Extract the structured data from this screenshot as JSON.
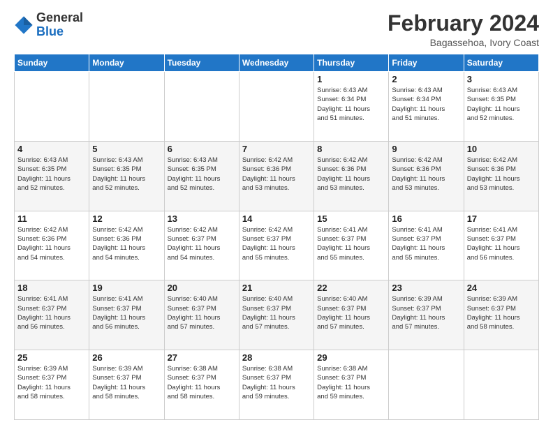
{
  "logo": {
    "general": "General",
    "blue": "Blue"
  },
  "title": "February 2024",
  "location": "Bagassehoa, Ivory Coast",
  "weekdays": [
    "Sunday",
    "Monday",
    "Tuesday",
    "Wednesday",
    "Thursday",
    "Friday",
    "Saturday"
  ],
  "weeks": [
    [
      {
        "day": "",
        "info": ""
      },
      {
        "day": "",
        "info": ""
      },
      {
        "day": "",
        "info": ""
      },
      {
        "day": "",
        "info": ""
      },
      {
        "day": "1",
        "info": "Sunrise: 6:43 AM\nSunset: 6:34 PM\nDaylight: 11 hours\nand 51 minutes."
      },
      {
        "day": "2",
        "info": "Sunrise: 6:43 AM\nSunset: 6:34 PM\nDaylight: 11 hours\nand 51 minutes."
      },
      {
        "day": "3",
        "info": "Sunrise: 6:43 AM\nSunset: 6:35 PM\nDaylight: 11 hours\nand 52 minutes."
      }
    ],
    [
      {
        "day": "4",
        "info": "Sunrise: 6:43 AM\nSunset: 6:35 PM\nDaylight: 11 hours\nand 52 minutes."
      },
      {
        "day": "5",
        "info": "Sunrise: 6:43 AM\nSunset: 6:35 PM\nDaylight: 11 hours\nand 52 minutes."
      },
      {
        "day": "6",
        "info": "Sunrise: 6:43 AM\nSunset: 6:35 PM\nDaylight: 11 hours\nand 52 minutes."
      },
      {
        "day": "7",
        "info": "Sunrise: 6:42 AM\nSunset: 6:36 PM\nDaylight: 11 hours\nand 53 minutes."
      },
      {
        "day": "8",
        "info": "Sunrise: 6:42 AM\nSunset: 6:36 PM\nDaylight: 11 hours\nand 53 minutes."
      },
      {
        "day": "9",
        "info": "Sunrise: 6:42 AM\nSunset: 6:36 PM\nDaylight: 11 hours\nand 53 minutes."
      },
      {
        "day": "10",
        "info": "Sunrise: 6:42 AM\nSunset: 6:36 PM\nDaylight: 11 hours\nand 53 minutes."
      }
    ],
    [
      {
        "day": "11",
        "info": "Sunrise: 6:42 AM\nSunset: 6:36 PM\nDaylight: 11 hours\nand 54 minutes."
      },
      {
        "day": "12",
        "info": "Sunrise: 6:42 AM\nSunset: 6:36 PM\nDaylight: 11 hours\nand 54 minutes."
      },
      {
        "day": "13",
        "info": "Sunrise: 6:42 AM\nSunset: 6:37 PM\nDaylight: 11 hours\nand 54 minutes."
      },
      {
        "day": "14",
        "info": "Sunrise: 6:42 AM\nSunset: 6:37 PM\nDaylight: 11 hours\nand 55 minutes."
      },
      {
        "day": "15",
        "info": "Sunrise: 6:41 AM\nSunset: 6:37 PM\nDaylight: 11 hours\nand 55 minutes."
      },
      {
        "day": "16",
        "info": "Sunrise: 6:41 AM\nSunset: 6:37 PM\nDaylight: 11 hours\nand 55 minutes."
      },
      {
        "day": "17",
        "info": "Sunrise: 6:41 AM\nSunset: 6:37 PM\nDaylight: 11 hours\nand 56 minutes."
      }
    ],
    [
      {
        "day": "18",
        "info": "Sunrise: 6:41 AM\nSunset: 6:37 PM\nDaylight: 11 hours\nand 56 minutes."
      },
      {
        "day": "19",
        "info": "Sunrise: 6:41 AM\nSunset: 6:37 PM\nDaylight: 11 hours\nand 56 minutes."
      },
      {
        "day": "20",
        "info": "Sunrise: 6:40 AM\nSunset: 6:37 PM\nDaylight: 11 hours\nand 57 minutes."
      },
      {
        "day": "21",
        "info": "Sunrise: 6:40 AM\nSunset: 6:37 PM\nDaylight: 11 hours\nand 57 minutes."
      },
      {
        "day": "22",
        "info": "Sunrise: 6:40 AM\nSunset: 6:37 PM\nDaylight: 11 hours\nand 57 minutes."
      },
      {
        "day": "23",
        "info": "Sunrise: 6:39 AM\nSunset: 6:37 PM\nDaylight: 11 hours\nand 57 minutes."
      },
      {
        "day": "24",
        "info": "Sunrise: 6:39 AM\nSunset: 6:37 PM\nDaylight: 11 hours\nand 58 minutes."
      }
    ],
    [
      {
        "day": "25",
        "info": "Sunrise: 6:39 AM\nSunset: 6:37 PM\nDaylight: 11 hours\nand 58 minutes."
      },
      {
        "day": "26",
        "info": "Sunrise: 6:39 AM\nSunset: 6:37 PM\nDaylight: 11 hours\nand 58 minutes."
      },
      {
        "day": "27",
        "info": "Sunrise: 6:38 AM\nSunset: 6:37 PM\nDaylight: 11 hours\nand 58 minutes."
      },
      {
        "day": "28",
        "info": "Sunrise: 6:38 AM\nSunset: 6:37 PM\nDaylight: 11 hours\nand 59 minutes."
      },
      {
        "day": "29",
        "info": "Sunrise: 6:38 AM\nSunset: 6:37 PM\nDaylight: 11 hours\nand 59 minutes."
      },
      {
        "day": "",
        "info": ""
      },
      {
        "day": "",
        "info": ""
      }
    ]
  ]
}
